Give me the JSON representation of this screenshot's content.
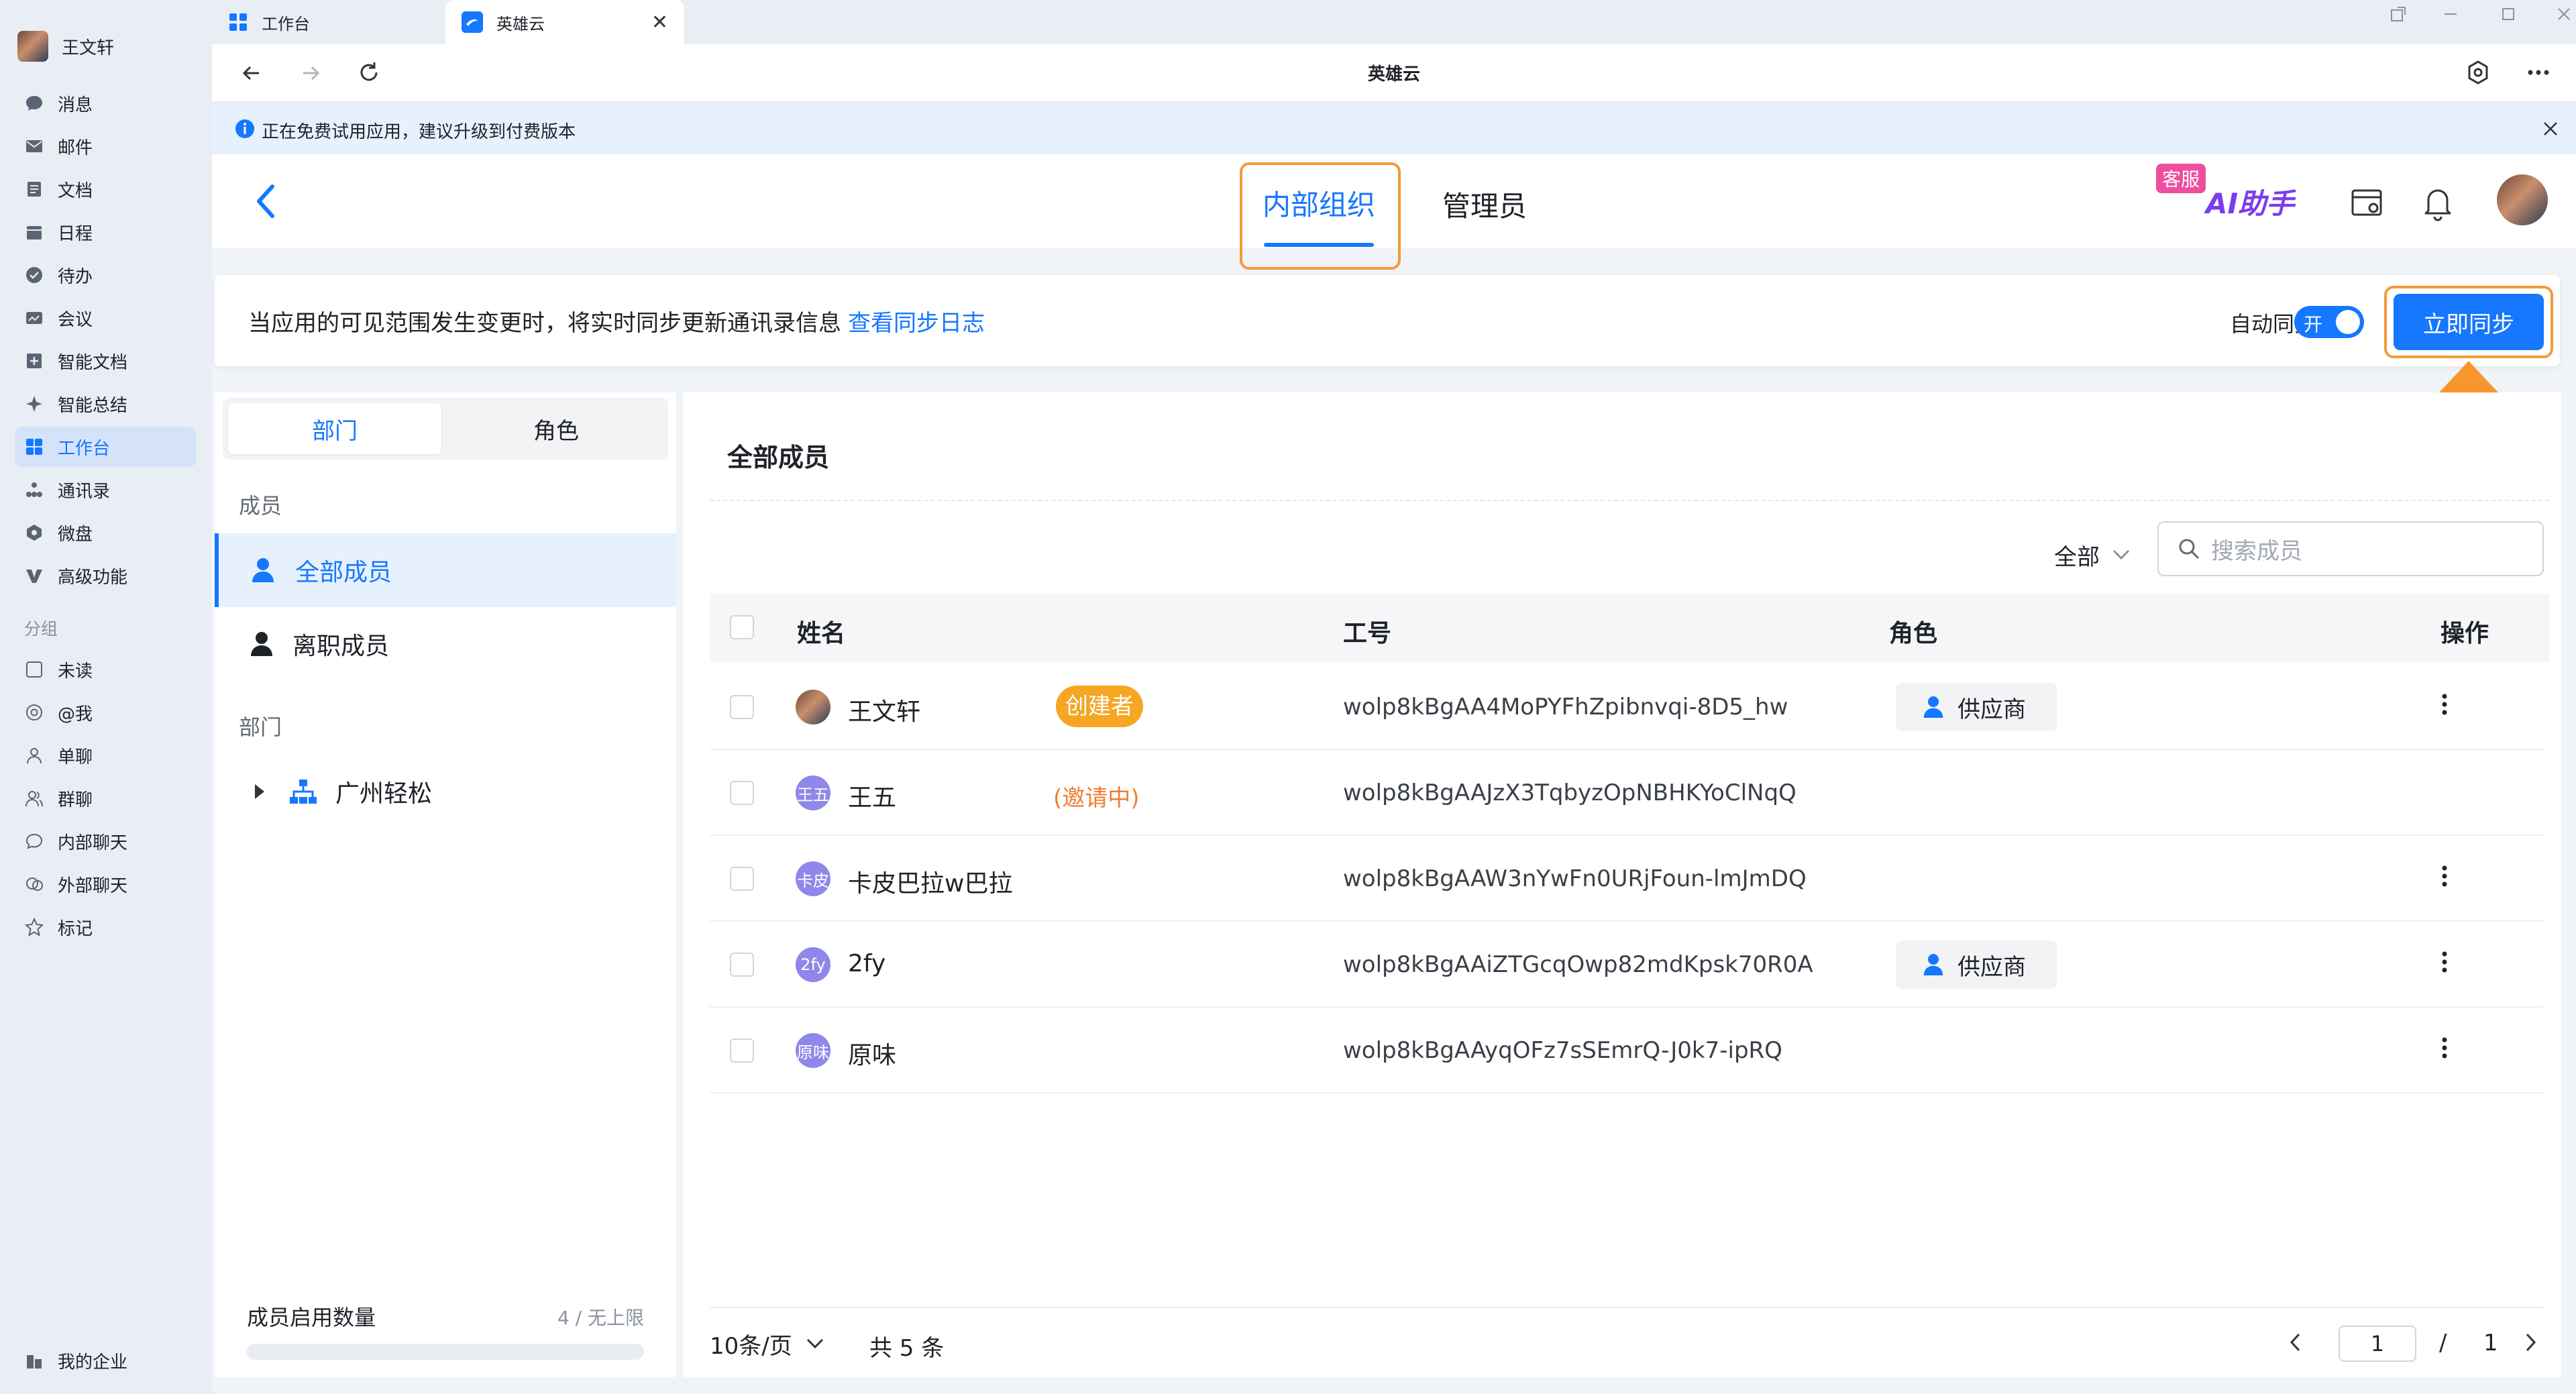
{
  "user": {
    "name": "王文轩"
  },
  "nav": {
    "items": [
      {
        "label": "消息",
        "icon": "chat-bubble-icon"
      },
      {
        "label": "邮件",
        "icon": "mail-icon"
      },
      {
        "label": "文档",
        "icon": "document-icon"
      },
      {
        "label": "日程",
        "icon": "calendar-icon"
      },
      {
        "label": "待办",
        "icon": "todo-check-icon"
      },
      {
        "label": "会议",
        "icon": "meeting-icon"
      },
      {
        "label": "智能文档",
        "icon": "smart-doc-icon"
      },
      {
        "label": "智能总结",
        "icon": "sparkle-icon"
      },
      {
        "label": "工作台",
        "icon": "grid-icon"
      },
      {
        "label": "通讯录",
        "icon": "org-chart-icon"
      },
      {
        "label": "微盘",
        "icon": "cloud-disk-icon"
      },
      {
        "label": "高级功能",
        "icon": "premium-v-icon"
      }
    ],
    "group_title": "分组",
    "group_items": [
      {
        "label": "未读",
        "icon": "unread-icon"
      },
      {
        "label": "@我",
        "icon": "at-icon"
      },
      {
        "label": "单聊",
        "icon": "single-user-icon"
      },
      {
        "label": "群聊",
        "icon": "group-users-icon"
      },
      {
        "label": "内部聊天",
        "icon": "internal-chat-icon"
      },
      {
        "label": "外部聊天",
        "icon": "external-chat-icon"
      },
      {
        "label": "标记",
        "icon": "star-icon"
      }
    ],
    "bottom_label": "我的企业"
  },
  "tabs": [
    {
      "label": "工作台"
    },
    {
      "label": "英雄云"
    }
  ],
  "address": {
    "title": "英雄云"
  },
  "notice": {
    "text": "正在免费试用应用，建议升级到付费版本"
  },
  "header": {
    "tab_internal": "内部组织",
    "tab_admin": "管理员",
    "kefu_badge": "客服",
    "ai_label": "AI助手"
  },
  "sync": {
    "description": "当应用的可见范围发生变更时，将实时同步更新通讯录信息",
    "log_link": "查看同步日志",
    "auto_label": "自动同步",
    "toggle_text": "开",
    "sync_button": "立即同步"
  },
  "left_panel": {
    "seg_department": "部门",
    "seg_role": "角色",
    "members_title": "成员",
    "all_members": "全部成员",
    "left_members": "离职成员",
    "dept_title": "部门",
    "dept_name": "广州轻松",
    "quota_label": "成员启用数量",
    "quota_value": "4 / 无上限"
  },
  "main": {
    "title": "全部成员",
    "filter_label": "全部",
    "search_placeholder": "搜索成员",
    "columns": {
      "name": "姓名",
      "id": "工号",
      "role": "角色",
      "action": "操作"
    },
    "rows": [
      {
        "avatar": "",
        "name": "王文轩",
        "badge": "创建者",
        "badge_type": "creator",
        "id": "wolp8kBgAA4MoPYFhZpibnvqi-8D5_hw",
        "role": "供应商",
        "has_action": true
      },
      {
        "avatar": "王五",
        "name": "王五",
        "badge": "(邀请中)",
        "badge_type": "inviting",
        "id": "wolp8kBgAAJzX3TqbyzOpNBHKYoClNqQ",
        "role": "",
        "has_action": false
      },
      {
        "avatar": "卡皮",
        "name": "卡皮巴拉w巴拉",
        "badge": "",
        "badge_type": "",
        "id": "wolp8kBgAAW3nYwFn0URjFoun-lmJmDQ",
        "role": "",
        "has_action": true
      },
      {
        "avatar": "2fy",
        "name": "2fy",
        "badge": "",
        "badge_type": "",
        "id": "wolp8kBgAAiZTGcqOwp82mdKpsk70R0A",
        "role": "供应商",
        "has_action": true
      },
      {
        "avatar": "原味",
        "name": "原味",
        "badge": "",
        "badge_type": "",
        "id": "wolp8kBgAAyqOFz7sSEmrQ-J0k7-ipRQ",
        "role": "",
        "has_action": true
      }
    ],
    "pagination": {
      "page_size": "10条/页",
      "total": "共 5 条",
      "current_page": "1",
      "separator": "/",
      "total_pages": "1"
    }
  },
  "colors": {
    "accent": "#1677ff",
    "highlight_border": "#f39a3b",
    "creator_badge": "#f5a623",
    "inviting": "#f07d33"
  }
}
